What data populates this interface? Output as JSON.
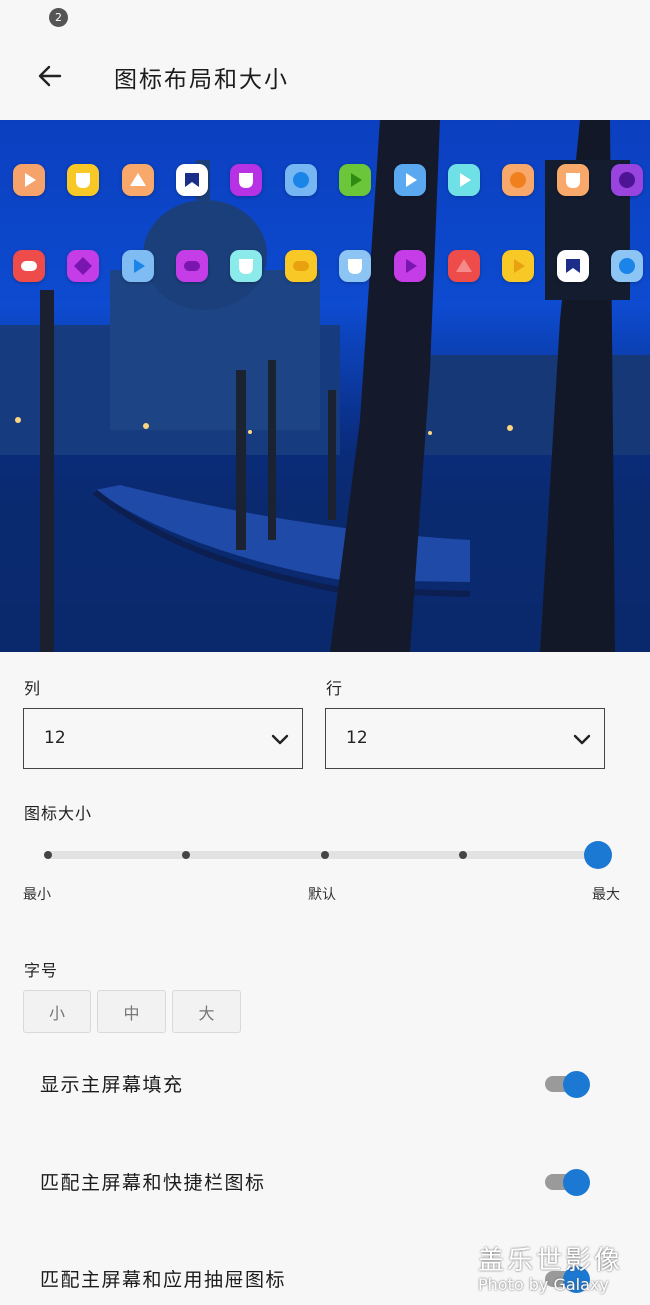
{
  "status_bar": {
    "notification_count": "2"
  },
  "header": {
    "title": "图标布局和大小",
    "back_icon": "arrow-left-icon"
  },
  "preview": {
    "row1": [
      {
        "bg": "#f6a36b",
        "fg": "#ffffff",
        "shape": "play"
      },
      {
        "bg": "#f8c826",
        "fg": "#ffffff",
        "shape": "shield"
      },
      {
        "bg": "#f8a86a",
        "fg": "#ffffff",
        "shape": "triangle"
      },
      {
        "bg": "#ffffff",
        "fg": "#1c2e8a",
        "shape": "bookmark"
      },
      {
        "bg": "#b632e4",
        "fg": "#ffffff",
        "shape": "shield"
      },
      {
        "bg": "#76b6f2",
        "fg": "#1a84e8",
        "shape": "circle"
      },
      {
        "bg": "#6cc63a",
        "fg": "#2f8a12",
        "shape": "play"
      },
      {
        "bg": "#5aa9f0",
        "fg": "#ffffff",
        "shape": "play"
      },
      {
        "bg": "#6fe0e6",
        "fg": "#ffffff",
        "shape": "play"
      },
      {
        "bg": "#f8a86a",
        "fg": "#f0801e",
        "shape": "circle"
      },
      {
        "bg": "#f8a86a",
        "fg": "#ffffff",
        "shape": "shield"
      },
      {
        "bg": "#9a44e0",
        "fg": "#4e1496",
        "shape": "circle"
      }
    ],
    "row2": [
      {
        "bg": "#ee4b4b",
        "fg": "#ffffff",
        "shape": "pill"
      },
      {
        "bg": "#c53de6",
        "fg": "#7a16b0",
        "shape": "diamond"
      },
      {
        "bg": "#7fbcf4",
        "fg": "#1a84e8",
        "shape": "play"
      },
      {
        "bg": "#c53de6",
        "fg": "#7a16b0",
        "shape": "pill"
      },
      {
        "bg": "#8beaea",
        "fg": "#ffffff",
        "shape": "shield"
      },
      {
        "bg": "#f8c826",
        "fg": "#e8a210",
        "shape": "pill"
      },
      {
        "bg": "#8cc4f4",
        "fg": "#ffffff",
        "shape": "shield"
      },
      {
        "bg": "#c53de6",
        "fg": "#7a16b0",
        "shape": "play"
      },
      {
        "bg": "#ee4b4b",
        "fg": "#f58a8a",
        "shape": "triangle"
      },
      {
        "bg": "#f8c826",
        "fg": "#e8a210",
        "shape": "play"
      },
      {
        "bg": "#ffffff",
        "fg": "#1c2e8a",
        "shape": "bookmark"
      },
      {
        "bg": "#8cc4f4",
        "fg": "#1a84e8",
        "shape": "circle"
      }
    ]
  },
  "layout": {
    "columns_label": "列",
    "columns_value": "12",
    "rows_label": "行",
    "rows_value": "12"
  },
  "icon_size": {
    "label": "图标大小",
    "min_label": "最小",
    "default_label": "默认",
    "max_label": "最大",
    "level_index": 4,
    "level_count": 5
  },
  "font_size": {
    "label": "字号",
    "options": [
      "小",
      "中",
      "大"
    ]
  },
  "toggles": [
    {
      "label": "显示主屏幕填充",
      "on": true
    },
    {
      "label": "匹配主屏幕和快捷栏图标",
      "on": true
    },
    {
      "label": "匹配主屏幕和应用抽屉图标",
      "on": true
    }
  ],
  "watermark": {
    "line1": "盖乐世影像",
    "line2": "Photo by Galaxy"
  },
  "colors": {
    "accent": "#1b79d3",
    "background": "#f7f7f7"
  }
}
